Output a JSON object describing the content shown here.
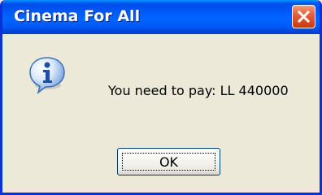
{
  "dialog": {
    "title": "Cinema For All",
    "message": "You need to pay: LL 440000",
    "icon": "info-icon",
    "ok_label": "OK",
    "close_icon": "close-icon"
  },
  "colors": {
    "titlebar": "#0058f4",
    "frame": "#0831d9",
    "client_bg": "#ece9d8",
    "close_button": "#d9471e"
  }
}
